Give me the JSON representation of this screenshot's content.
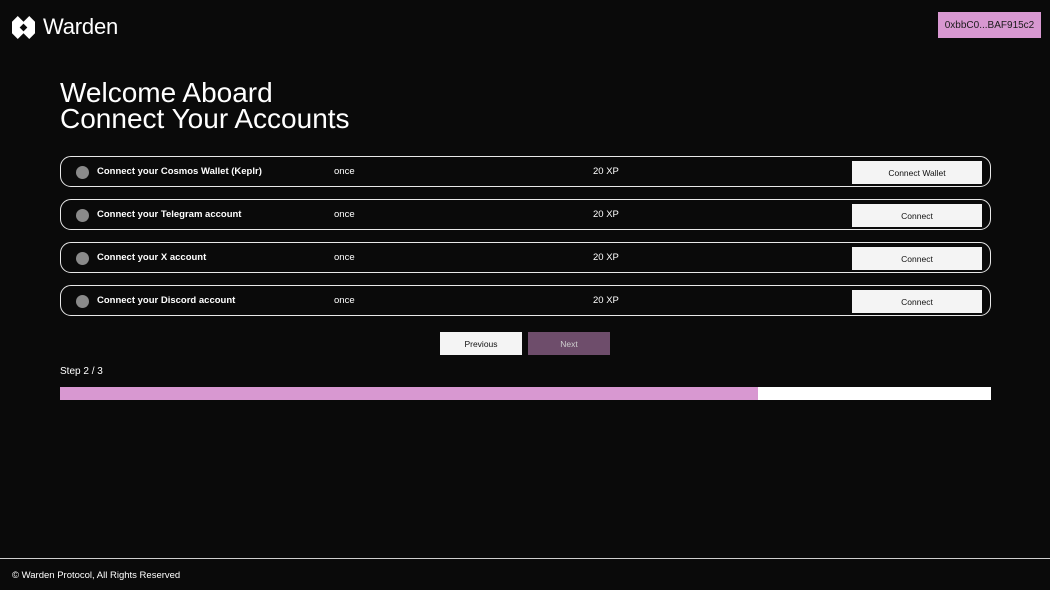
{
  "header": {
    "logo_text": "Warden",
    "logo_icon": "warden-logo-icon",
    "wallet_address": "0xbbC0...BAF915c2"
  },
  "title": {
    "line1": "Welcome Aboard",
    "line2": "Connect Your Accounts"
  },
  "tasks": [
    {
      "label": "Connect your Cosmos Wallet (Keplr)",
      "frequency": "once",
      "xp": "20 XP",
      "action": "Connect Wallet"
    },
    {
      "label": "Connect your Telegram account",
      "frequency": "once",
      "xp": "20 XP",
      "action": "Connect"
    },
    {
      "label": "Connect your X account",
      "frequency": "once",
      "xp": "20 XP",
      "action": "Connect"
    },
    {
      "label": "Connect your Discord account",
      "frequency": "once",
      "xp": "20 XP",
      "action": "Connect"
    }
  ],
  "nav": {
    "previous": "Previous",
    "next": "Next"
  },
  "step": {
    "label": "Step 2 / 3",
    "progress": 0.75
  },
  "footer": {
    "text": "© Warden Protocol, All Rights Reserved"
  },
  "colors": {
    "background": "#0a0a0a",
    "accent": "#d898d1",
    "next_button": "#6e4d6b",
    "status_dot": "#8a8a8a"
  }
}
